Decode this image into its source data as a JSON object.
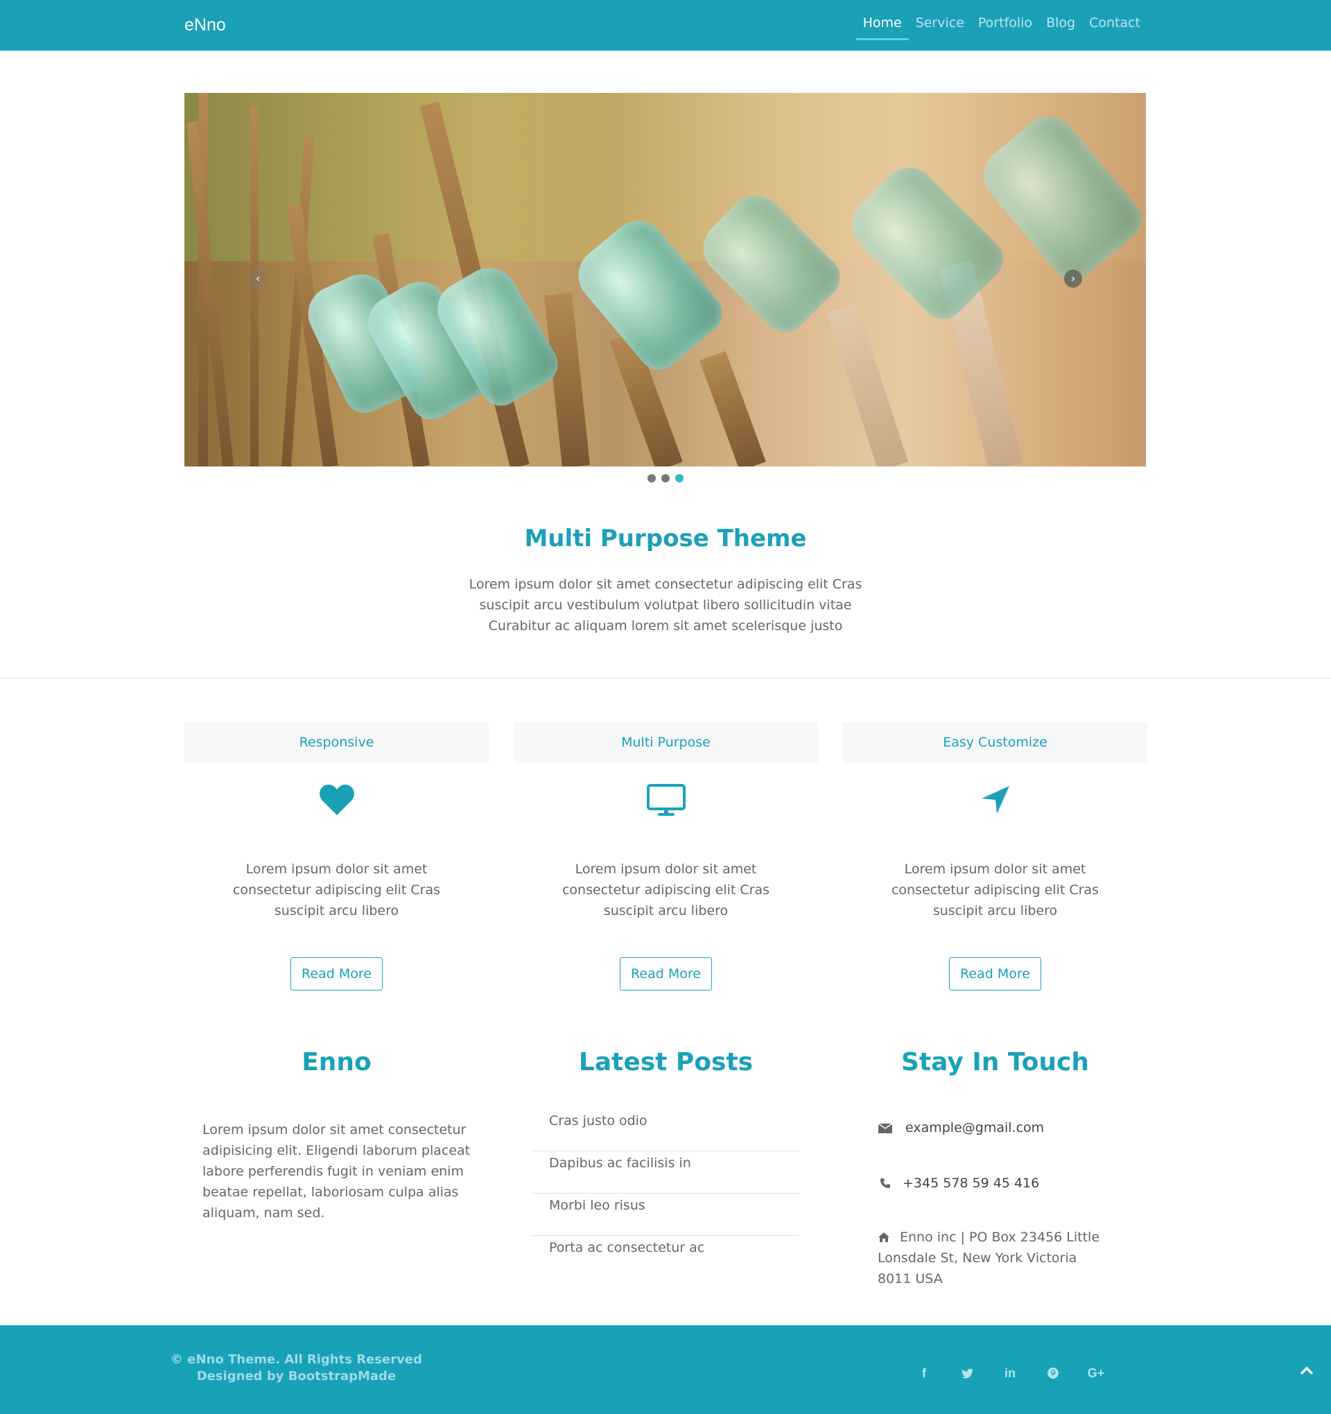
{
  "navbar": {
    "brand": "eNno",
    "items": [
      {
        "label": "Home",
        "active": true
      },
      {
        "label": "Service",
        "active": false
      },
      {
        "label": "Portfolio",
        "active": false
      },
      {
        "label": "Blog",
        "active": false
      },
      {
        "label": "Contact",
        "active": false
      }
    ]
  },
  "carousel": {
    "prev_icon": "chevron-left-icon",
    "next_icon": "chevron-right-icon",
    "slide_count": 3,
    "active_slide": 3
  },
  "hero": {
    "title": "Multi Purpose Theme",
    "text": "Lorem ipsum dolor sit amet consectetur adipiscing elit Cras suscipit arcu vestibulum volutpat libero sollicitudin vitae Curabitur ac aliquam lorem sit amet scelerisque justo"
  },
  "features": [
    {
      "title": "Responsive",
      "icon": "heart-icon",
      "text": "Lorem ipsum dolor sit amet consectetur adipiscing elit Cras suscipit arcu libero",
      "button": "Read More"
    },
    {
      "title": "Multi Purpose",
      "icon": "desktop-icon",
      "text": "Lorem ipsum dolor sit amet consectetur adipiscing elit Cras suscipit arcu libero",
      "button": "Read More"
    },
    {
      "title": "Easy Customize",
      "icon": "location-arrow-icon",
      "text": "Lorem ipsum dolor sit amet consectetur adipiscing elit Cras suscipit arcu libero",
      "button": "Read More"
    }
  ],
  "about": {
    "title": "Enno",
    "text": "Lorem ipsum dolor sit amet consectetur adipisicing elit. Eligendi laborum placeat labore perferendis fugit in veniam enim beatae repellat, laboriosam culpa alias aliquam, nam sed."
  },
  "posts": {
    "title": "Latest Posts",
    "items": [
      "Cras justo odio",
      "Dapibus ac facilisis in",
      "Morbi leo risus",
      "Porta ac consectetur ac"
    ]
  },
  "contact": {
    "title": "Stay In Touch",
    "email": "example@gmail.com",
    "phone": "+345 578 59 45 416",
    "address": "Enno inc | PO Box 23456 Little Lonsdale St, New York Victoria 8011 USA",
    "icons": [
      "envelope-icon",
      "phone-icon",
      "home-icon"
    ]
  },
  "footer": {
    "copyright": "© eNno Theme. All Rights Reserved",
    "credit": "Designed by BootstrapMade",
    "social": [
      {
        "name": "facebook-icon",
        "glyph": "f"
      },
      {
        "name": "twitter-icon",
        "glyph": ""
      },
      {
        "name": "linkedin-icon",
        "glyph": "in"
      },
      {
        "name": "pinterest-icon",
        "glyph": ""
      },
      {
        "name": "google-plus-icon",
        "glyph": "G+"
      }
    ],
    "back_to_top_icon": "chevron-up-icon"
  },
  "colors": {
    "accent": "#1aa1b8",
    "footer": "#17a2b8",
    "text": "#666666"
  }
}
